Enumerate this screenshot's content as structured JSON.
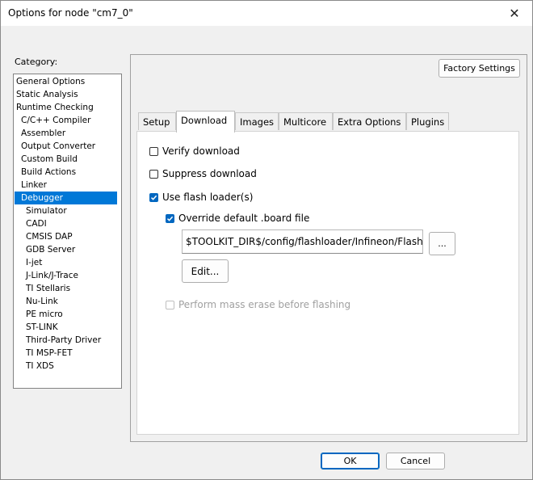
{
  "window": {
    "title": "Options for node \"cm7_0\""
  },
  "category": {
    "label": "Category:",
    "items": [
      {
        "label": "General Options"
      },
      {
        "label": "Static Analysis"
      },
      {
        "label": "Runtime Checking"
      },
      {
        "label": "C/C++ Compiler"
      },
      {
        "label": "Assembler"
      },
      {
        "label": "Output Converter"
      },
      {
        "label": "Custom Build"
      },
      {
        "label": "Build Actions"
      },
      {
        "label": "Linker"
      },
      {
        "label": "Debugger"
      },
      {
        "label": "Simulator"
      },
      {
        "label": "CADI"
      },
      {
        "label": "CMSIS DAP"
      },
      {
        "label": "GDB Server"
      },
      {
        "label": "I-jet"
      },
      {
        "label": "J-Link/J-Trace"
      },
      {
        "label": "TI Stellaris"
      },
      {
        "label": "Nu-Link"
      },
      {
        "label": "PE micro"
      },
      {
        "label": "ST-LINK"
      },
      {
        "label": "Third-Party Driver"
      },
      {
        "label": "TI MSP-FET"
      },
      {
        "label": "TI XDS"
      }
    ],
    "selected": "Debugger"
  },
  "factory_settings_label": "Factory Settings",
  "tabs": [
    {
      "label": "Setup"
    },
    {
      "label": "Download"
    },
    {
      "label": "Images"
    },
    {
      "label": "Multicore"
    },
    {
      "label": "Extra Options"
    },
    {
      "label": "Plugins"
    }
  ],
  "active_tab": "Download",
  "download": {
    "verify": {
      "label": "Verify download",
      "checked": false
    },
    "suppress": {
      "label": "Suppress download",
      "checked": false
    },
    "flash_loader": {
      "label": "Use flash loader(s)",
      "checked": true
    },
    "override": {
      "label": "Override default .board file",
      "checked": true
    },
    "board_path": "$TOOLKIT_DIR$/config/flashloader/Infineon/FlashC",
    "browse_label": "...",
    "edit_label": "Edit...",
    "mass_erase": {
      "label": "Perform mass erase before flashing",
      "checked": false,
      "disabled": true
    }
  },
  "buttons": {
    "ok": "OK",
    "cancel": "Cancel"
  },
  "colors": {
    "selection": "#0078d7",
    "accent": "#0067c0"
  }
}
